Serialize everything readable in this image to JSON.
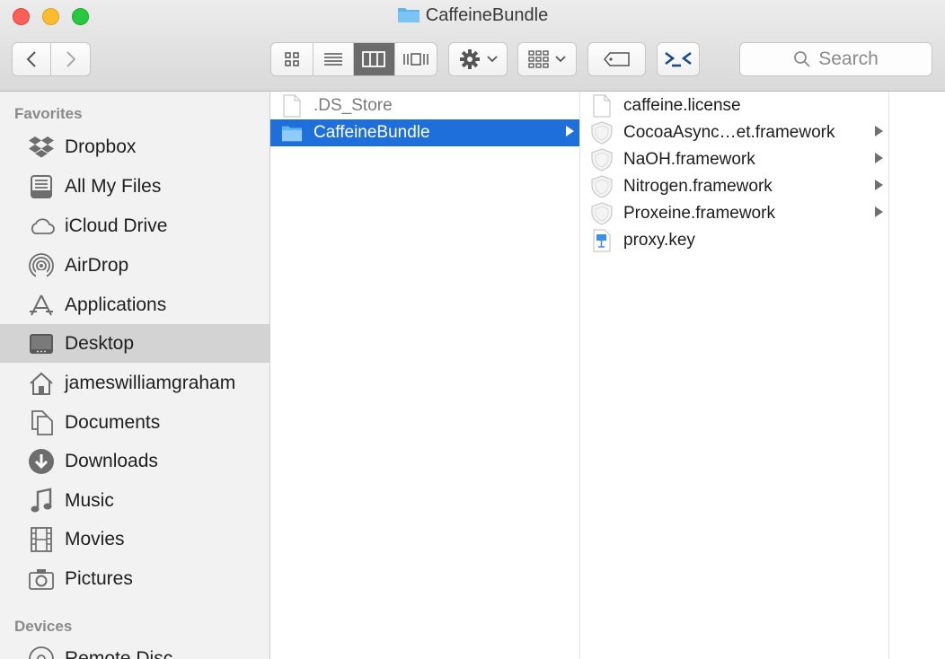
{
  "window": {
    "title": "CaffeineBundle"
  },
  "toolbar": {
    "back_icon": "chevron-left-icon",
    "forward_icon": "chevron-right-icon",
    "view_modes": [
      "icon-view",
      "list-view",
      "column-view",
      "cover-flow-view"
    ],
    "active_view": "column-view",
    "action_icon": "gear-icon",
    "arrange_icon": "arrange-grid-icon",
    "tags_icon": "tag-icon",
    "terminal_icon": "terminal-icon",
    "search_placeholder": "Search"
  },
  "sidebar": {
    "favorites_heading": "Favorites",
    "devices_heading": "Devices",
    "items": [
      {
        "label": "Dropbox",
        "icon": "dropbox-icon"
      },
      {
        "label": "All My Files",
        "icon": "all-my-files-icon"
      },
      {
        "label": "iCloud Drive",
        "icon": "cloud-icon"
      },
      {
        "label": "AirDrop",
        "icon": "airdrop-icon"
      },
      {
        "label": "Applications",
        "icon": "applications-icon"
      },
      {
        "label": "Desktop",
        "icon": "desktop-icon",
        "selected": true
      },
      {
        "label": "jameswilliamgraham",
        "icon": "home-icon"
      },
      {
        "label": "Documents",
        "icon": "documents-icon"
      },
      {
        "label": "Downloads",
        "icon": "downloads-icon"
      },
      {
        "label": "Music",
        "icon": "music-icon"
      },
      {
        "label": "Movies",
        "icon": "movies-icon"
      },
      {
        "label": "Pictures",
        "icon": "pictures-icon"
      }
    ],
    "devices": [
      {
        "label": "Remote Disc",
        "icon": "disc-icon"
      }
    ]
  },
  "columns": [
    {
      "items": [
        {
          "name": ".DS_Store",
          "icon": "document-icon",
          "dimmed": true
        },
        {
          "name": "CaffeineBundle",
          "icon": "folder-icon",
          "selected": true,
          "has_children": true
        }
      ]
    },
    {
      "items": [
        {
          "name": "caffeine.license",
          "icon": "document-icon"
        },
        {
          "name": "CocoaAsync…et.framework",
          "icon": "framework-icon",
          "has_children": true
        },
        {
          "name": "NaOH.framework",
          "icon": "framework-icon",
          "has_children": true
        },
        {
          "name": "Nitrogen.framework",
          "icon": "framework-icon",
          "has_children": true
        },
        {
          "name": "Proxeine.framework",
          "icon": "framework-icon",
          "has_children": true
        },
        {
          "name": "proxy.key",
          "icon": "keynote-icon"
        }
      ]
    }
  ],
  "colors": {
    "selection": "#1e6fd9",
    "folder": "#5fb3f0",
    "sidebar_bg": "#f2f2f2",
    "sidebar_selected": "#d3d3d3"
  }
}
